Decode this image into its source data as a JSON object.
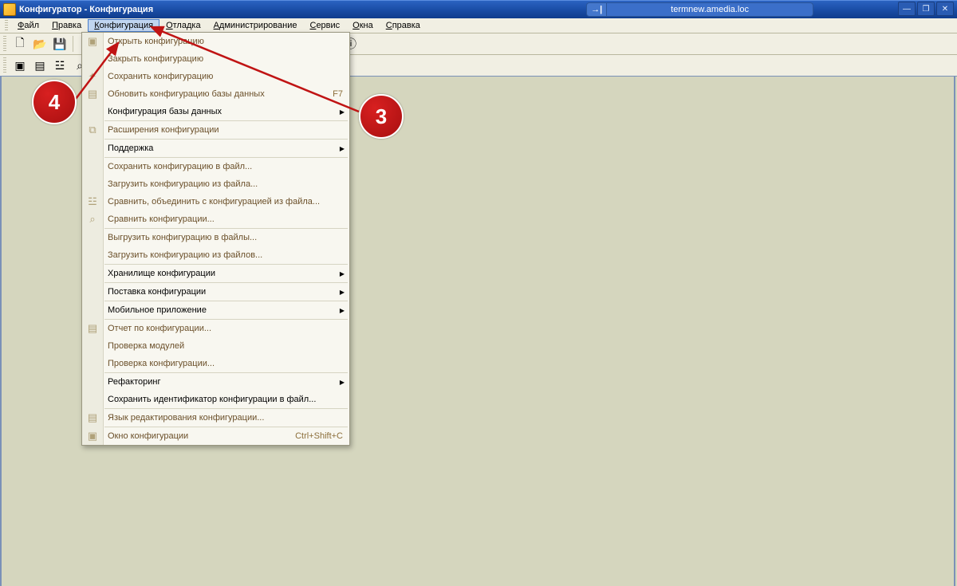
{
  "window": {
    "title": "Конфигуратор - Конфигурация",
    "server": "termnew.amedia.loc"
  },
  "menubar": {
    "items": [
      {
        "label": "Файл",
        "ul": "Ф"
      },
      {
        "label": "Правка",
        "ul": "П"
      },
      {
        "label": "Конфигурация",
        "ul": "К",
        "active": true
      },
      {
        "label": "Отладка",
        "ul": "О"
      },
      {
        "label": "Администрирование",
        "ul": "А"
      },
      {
        "label": "Сервис",
        "ul": "С"
      },
      {
        "label": "Окна",
        "ul": "О"
      },
      {
        "label": "Справка",
        "ul": "С"
      }
    ]
  },
  "dropdown": {
    "items": [
      {
        "label": "Открыть конфигурацию",
        "icon": "▣"
      },
      {
        "label": "Закрыть конфигурацию"
      },
      {
        "label": "Сохранить конфигурацию",
        "icon": "✦"
      },
      {
        "label": "Обновить конфигурацию базы данных",
        "icon": "▤",
        "shortcut": "F7"
      },
      {
        "label": "Конфигурация базы данных",
        "bold": true,
        "submenu": true
      },
      {
        "sep": true
      },
      {
        "label": "Расширения конфигурации",
        "icon": "⧉"
      },
      {
        "sep": true
      },
      {
        "label": "Поддержка",
        "bold": true,
        "submenu": true
      },
      {
        "sep": true
      },
      {
        "label": "Сохранить конфигурацию в файл..."
      },
      {
        "label": "Загрузить конфигурацию из файла..."
      },
      {
        "label": "Сравнить, объединить с конфигурацией из файла...",
        "icon": "☳"
      },
      {
        "label": "Сравнить конфигурации...",
        "icon": "⌕"
      },
      {
        "sep": true
      },
      {
        "label": "Выгрузить конфигурацию в файлы..."
      },
      {
        "label": "Загрузить конфигурацию из файлов..."
      },
      {
        "sep": true
      },
      {
        "label": "Хранилище конфигурации",
        "bold": true,
        "submenu": true
      },
      {
        "sep": true
      },
      {
        "label": "Поставка конфигурации",
        "bold": true,
        "submenu": true
      },
      {
        "sep": true
      },
      {
        "label": "Мобильное приложение",
        "bold": true,
        "submenu": true
      },
      {
        "sep": true
      },
      {
        "label": "Отчет по конфигурации...",
        "icon": "▤"
      },
      {
        "label": "Проверка модулей"
      },
      {
        "label": "Проверка конфигурации..."
      },
      {
        "sep": true
      },
      {
        "label": "Рефакторинг",
        "bold": true,
        "submenu": true
      },
      {
        "label": "Сохранить идентификатор конфигурации в файл...",
        "bold": true
      },
      {
        "sep": true
      },
      {
        "label": "Язык редактирования конфигурации...",
        "icon": "▤"
      },
      {
        "sep": true
      },
      {
        "label": "Окно конфигурации",
        "icon": "▣",
        "shortcut": "Ctrl+Shift+C"
      }
    ]
  },
  "badges": {
    "left": "4",
    "right": "3"
  },
  "toolbar1_icons": [
    "new-doc-icon",
    "open-icon",
    "save-icon",
    "print-icon",
    "print-preview-icon",
    "copy-icon",
    "cut-icon",
    "paste-icon",
    "undo-icon",
    "redo-icon",
    "find-icon",
    "find-next-icon",
    "help-user-icon",
    "help-question-icon",
    "calendar-icon",
    "info-icon"
  ],
  "toolbar2_icons": [
    "config-tree-icon",
    "db-icon",
    "compare-icon",
    "syntax-icon"
  ],
  "toolbar1_glyphs": [
    "🗋",
    "📂",
    "💾",
    "🖶",
    "🗐",
    "📄",
    "✂",
    "📋",
    "↶",
    "↷",
    "🔍",
    "🔎",
    "👤",
    "❓",
    "🗓",
    "ⓘ"
  ],
  "toolbar2_glyphs": [
    "▣",
    "▤",
    "☳",
    "⌕"
  ]
}
